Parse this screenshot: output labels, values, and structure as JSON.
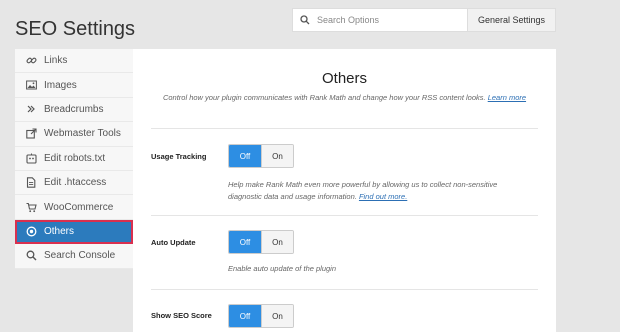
{
  "page": {
    "title": "SEO Settings"
  },
  "search": {
    "placeholder": "Search Options",
    "scope": "General Settings"
  },
  "sidebar": {
    "items": [
      {
        "label": "Links",
        "icon": "link-icon"
      },
      {
        "label": "Images",
        "icon": "image-icon"
      },
      {
        "label": "Breadcrumbs",
        "icon": "chevrons-right-icon"
      },
      {
        "label": "Webmaster Tools",
        "icon": "external-link-icon"
      },
      {
        "label": "Edit robots.txt",
        "icon": "robot-icon"
      },
      {
        "label": "Edit .htaccess",
        "icon": "file-icon"
      },
      {
        "label": "WooCommerce",
        "icon": "cart-icon"
      },
      {
        "label": "Others",
        "icon": "circle-dot-icon",
        "active": true
      },
      {
        "label": "Search Console",
        "icon": "search-icon"
      }
    ]
  },
  "main": {
    "title": "Others",
    "desc": "Control how your plugin communicates with Rank Math and change how your RSS content looks.",
    "learn_more": "Learn more",
    "options": [
      {
        "label": "Usage Tracking",
        "on_label": "Off",
        "off_label": "On",
        "help": "Help make Rank Math even more powerful by allowing us to collect non-sensitive diagnostic data and usage information.",
        "link": "Find out more."
      },
      {
        "label": "Auto Update",
        "on_label": "Off",
        "off_label": "On",
        "help": "Enable auto update of the plugin"
      },
      {
        "label": "Show SEO Score",
        "on_label": "Off",
        "off_label": "On"
      }
    ]
  },
  "colors": {
    "accent": "#2d8ee3",
    "active_nav": "#2c7bbd",
    "highlight_outline": "#d9304f"
  }
}
